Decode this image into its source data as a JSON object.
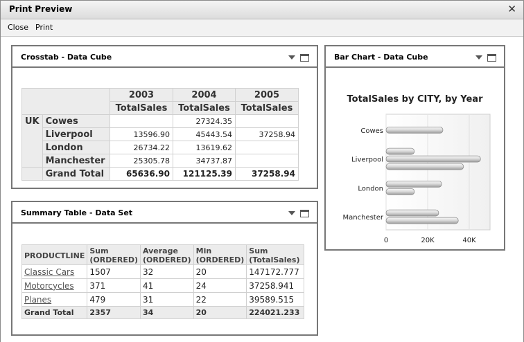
{
  "window": {
    "title": "Print Preview",
    "close_glyph": "✕"
  },
  "menu": {
    "close": "Close",
    "print": "Print"
  },
  "crosstab": {
    "title": "Crosstab - Data Cube",
    "years": [
      "2003",
      "2004",
      "2005"
    ],
    "measure": "TotalSales",
    "country": "UK",
    "rows": [
      {
        "city": "Cowes",
        "v2003": "",
        "v2004": "27324.35",
        "v2005": ""
      },
      {
        "city": "Liverpool",
        "v2003": "13596.90",
        "v2004": "45443.54",
        "v2005": "37258.94"
      },
      {
        "city": "London",
        "v2003": "26734.22",
        "v2004": "13619.62",
        "v2005": ""
      },
      {
        "city": "Manchester",
        "v2003": "25305.78",
        "v2004": "34737.87",
        "v2005": ""
      }
    ],
    "grand_total": {
      "label": "Grand Total",
      "v2003": "65636.90",
      "v2004": "121125.39",
      "v2005": "37258.94"
    }
  },
  "summary": {
    "title": "Summary Table - Data Set",
    "headers": [
      "PRODUCTLINE",
      "Sum\n(ORDERED)",
      "Average\n(ORDERED)",
      "Min\n(ORDERED)",
      "Sum\n(TotalSales)"
    ],
    "rows": [
      {
        "line": "Classic Cars",
        "sum": "1507",
        "avg": "32",
        "min": "20",
        "total": "147172.777"
      },
      {
        "line": "Motorcycles",
        "sum": "371",
        "avg": "41",
        "min": "24",
        "total": "37258.941"
      },
      {
        "line": "Planes",
        "sum": "479",
        "avg": "31",
        "min": "22",
        "total": "39589.515"
      }
    ],
    "grand_total": {
      "label": "Grand Total",
      "sum": "2357",
      "avg": "34",
      "min": "20",
      "total": "224021.233"
    }
  },
  "barchart_panel": {
    "title": "Bar Chart - Data Cube"
  },
  "chart_data": {
    "type": "bar",
    "orientation": "horizontal",
    "title": "TotalSales by CITY, by Year",
    "categories": [
      "Cowes",
      "Liverpool",
      "London",
      "Manchester"
    ],
    "series": [
      {
        "values": [
          0,
          13596.9,
          26734.22,
          25305.78
        ]
      },
      {
        "values": [
          27324.35,
          45443.54,
          13619.62,
          34737.87
        ]
      },
      {
        "values": [
          0,
          37258.94,
          0,
          0
        ]
      }
    ],
    "xlim": [
      0,
      50000
    ],
    "xticks": [
      0,
      20000,
      40000
    ],
    "xtick_labels": [
      "0",
      "20K",
      "40K"
    ],
    "grid": true,
    "legend": "none"
  }
}
